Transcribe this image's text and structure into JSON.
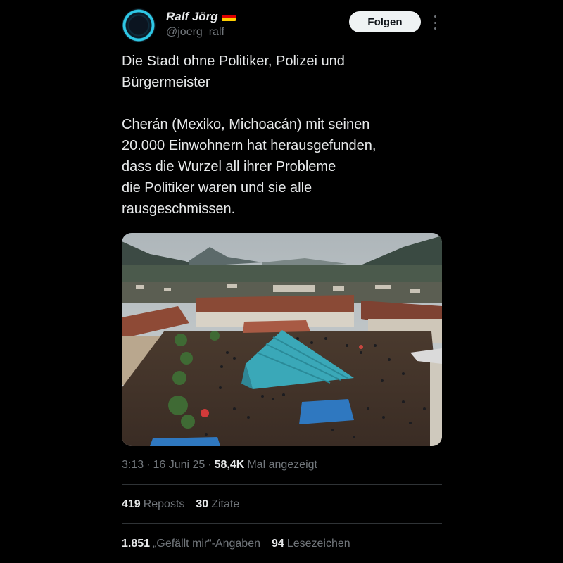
{
  "author": {
    "name": "Ralf Jörg",
    "handle": "@joerg_ralf",
    "flag": "germany-flag"
  },
  "follow_button": {
    "label": "Folgen"
  },
  "tweet": {
    "paragraph1": "Die Stadt ohne Politiker, Polizei und\nBürgermeister",
    "paragraph2": "Cherán (Mexiko, Michoacán) mit seinen\n20.000 Einwohnern hat herausgefunden,\ndass die Wurzel all ihrer Probleme\ndie Politiker waren und sie alle\nrausgeschmissen."
  },
  "media": {
    "description_icon": "town-square-photo"
  },
  "meta": {
    "time": "3:13",
    "sep1": "·",
    "date": "16 Juni 25",
    "sep2": "·",
    "views_count": "58,4K",
    "views_label": "Mal angezeigt"
  },
  "stats1": {
    "reposts_count": "419",
    "reposts_label": "Reposts",
    "quotes_count": "30",
    "quotes_label": "Zitate"
  },
  "stats2": {
    "likes_count": "1.851",
    "likes_label": "„Gefällt mir“-Angaben",
    "bookmarks_count": "94",
    "bookmarks_label": "Lesezeichen"
  },
  "colors": {
    "background": "#000000",
    "text": "#e7e9ea",
    "muted": "#71767b",
    "divider": "#2f3336",
    "tarp": "#3aa8b8"
  }
}
